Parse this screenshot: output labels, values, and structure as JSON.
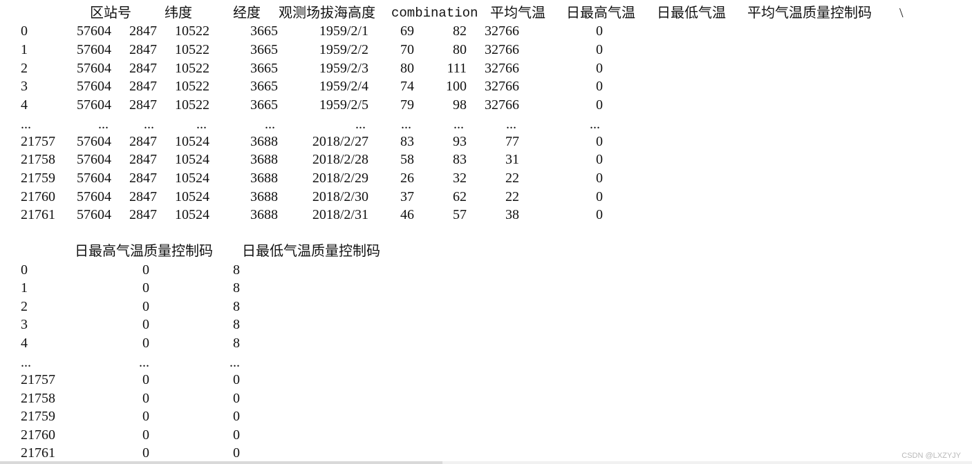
{
  "table1": {
    "headers": [
      "区站号",
      "纬度",
      "经度",
      "观测场拔海高度",
      "combination",
      "平均气温",
      "日最高气温",
      "日最低气温",
      "平均气温质量控制码"
    ],
    "continuation": "\\",
    "rows": [
      [
        "0",
        "57604",
        "2847",
        "10522",
        "3665",
        "1959/2/1",
        "69",
        "82",
        "32766",
        "0"
      ],
      [
        "1",
        "57604",
        "2847",
        "10522",
        "3665",
        "1959/2/2",
        "70",
        "80",
        "32766",
        "0"
      ],
      [
        "2",
        "57604",
        "2847",
        "10522",
        "3665",
        "1959/2/3",
        "80",
        "111",
        "32766",
        "0"
      ],
      [
        "3",
        "57604",
        "2847",
        "10522",
        "3665",
        "1959/2/4",
        "74",
        "100",
        "32766",
        "0"
      ],
      [
        "4",
        "57604",
        "2847",
        "10522",
        "3665",
        "1959/2/5",
        "79",
        "98",
        "32766",
        "0"
      ],
      [
        "...",
        "...",
        "...",
        "...",
        "...",
        "...",
        "...",
        "...",
        "...",
        "..."
      ],
      [
        "21757",
        "57604",
        "2847",
        "10524",
        "3688",
        "2018/2/27",
        "83",
        "93",
        "77",
        "0"
      ],
      [
        "21758",
        "57604",
        "2847",
        "10524",
        "3688",
        "2018/2/28",
        "58",
        "83",
        "31",
        "0"
      ],
      [
        "21759",
        "57604",
        "2847",
        "10524",
        "3688",
        "2018/2/29",
        "26",
        "32",
        "22",
        "0"
      ],
      [
        "21760",
        "57604",
        "2847",
        "10524",
        "3688",
        "2018/2/30",
        "37",
        "62",
        "22",
        "0"
      ],
      [
        "21761",
        "57604",
        "2847",
        "10524",
        "3688",
        "2018/2/31",
        "46",
        "57",
        "38",
        "0"
      ]
    ]
  },
  "table2": {
    "headers": [
      "日最高气温质量控制码",
      "日最低气温质量控制码"
    ],
    "rows": [
      [
        "0",
        "0",
        "8"
      ],
      [
        "1",
        "0",
        "8"
      ],
      [
        "2",
        "0",
        "8"
      ],
      [
        "3",
        "0",
        "8"
      ],
      [
        "4",
        "0",
        "8"
      ],
      [
        "...",
        "...",
        "..."
      ],
      [
        "21757",
        "0",
        "0"
      ],
      [
        "21758",
        "0",
        "0"
      ],
      [
        "21759",
        "0",
        "0"
      ],
      [
        "21760",
        "0",
        "0"
      ],
      [
        "21761",
        "0",
        "0"
      ]
    ]
  },
  "watermark": "CSDN @LXZYJY"
}
